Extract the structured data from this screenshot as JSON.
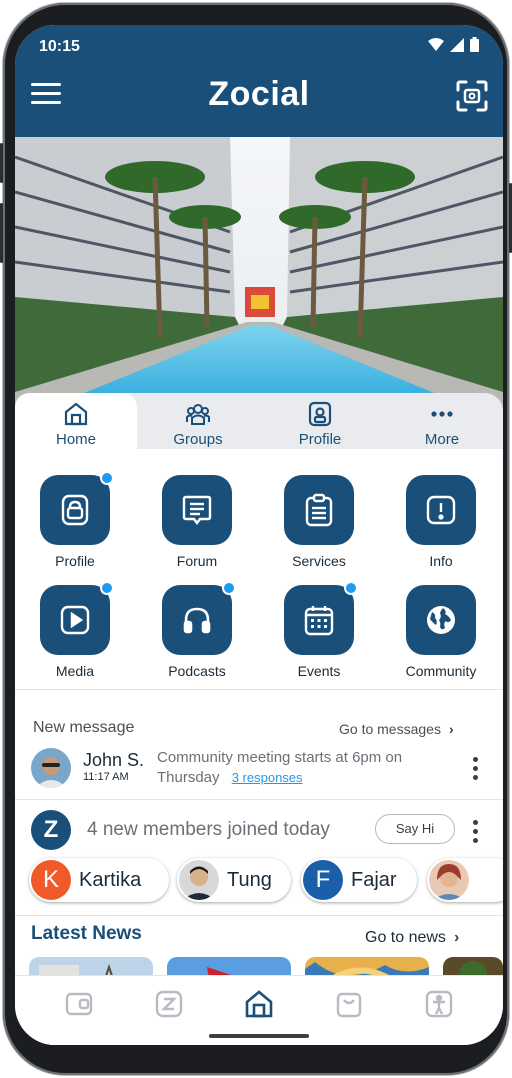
{
  "status_bar": {
    "time": "10:15"
  },
  "app_bar": {
    "logo": "Zocial"
  },
  "tabs": [
    {
      "label": "Home",
      "icon": "home-icon",
      "active": true
    },
    {
      "label": "Groups",
      "icon": "groups-icon"
    },
    {
      "label": "Profile",
      "icon": "profile-badge-icon"
    },
    {
      "label": "More",
      "icon": "more-dots-icon"
    }
  ],
  "tiles": [
    {
      "label": "Profile",
      "icon": "id-badge-icon",
      "badge": true
    },
    {
      "label": "Forum",
      "icon": "forum-icon",
      "badge": false
    },
    {
      "label": "Services",
      "icon": "clipboard-icon",
      "badge": false
    },
    {
      "label": "Info",
      "icon": "info-icon",
      "badge": false
    },
    {
      "label": "Media",
      "icon": "play-icon",
      "badge": true
    },
    {
      "label": "Podcasts",
      "icon": "headphones-icon",
      "badge": true
    },
    {
      "label": "Events",
      "icon": "calendar-icon",
      "badge": true
    },
    {
      "label": "Community",
      "icon": "globe-icon",
      "badge": false
    }
  ],
  "message": {
    "title": "New message",
    "goto_label": "Go to messages",
    "sender": "John S.",
    "time": "11:17 AM",
    "text": "Community meeting starts at 6pm on Thursday",
    "responses": "3 responses"
  },
  "members": {
    "badge": "Z",
    "text": "4 new members joined today",
    "say_hi": "Say Hi",
    "people": [
      {
        "name": "Kartika",
        "initial": "K",
        "color": "#f05a28"
      },
      {
        "name": "Tung",
        "initial": "",
        "color": "#6a6f75"
      },
      {
        "name": "Fajar",
        "initial": "F",
        "color": "#1a5fa8"
      },
      {
        "name": "",
        "initial": "",
        "color": "#c06a5a"
      }
    ]
  },
  "news": {
    "title": "Latest News",
    "goto_label": "Go to news"
  },
  "colors": {
    "primary": "#1a4f7a",
    "accent": "#1e9bf0",
    "tab_bg": "#e9ebee"
  },
  "bottom_nav": [
    {
      "icon": "wallet-icon"
    },
    {
      "icon": "zocial-z-icon"
    },
    {
      "icon": "home-nav-icon",
      "active": true
    },
    {
      "icon": "bag-icon"
    },
    {
      "icon": "accessibility-icon"
    }
  ]
}
